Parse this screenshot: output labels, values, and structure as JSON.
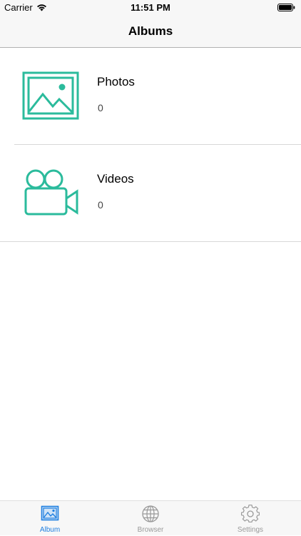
{
  "status_bar": {
    "carrier": "Carrier",
    "time": "11:51 PM"
  },
  "nav": {
    "title": "Albums"
  },
  "albums": [
    {
      "title": "Photos",
      "count": "0",
      "icon": "photo-icon"
    },
    {
      "title": "Videos",
      "count": "0",
      "icon": "video-camera-icon"
    }
  ],
  "tabs": [
    {
      "label": "Album",
      "icon": "image-icon",
      "active": true
    },
    {
      "label": "Browser",
      "icon": "globe-icon",
      "active": false
    },
    {
      "label": "Settings",
      "icon": "gear-icon",
      "active": false
    }
  ],
  "colors": {
    "accent": "#2bbb9c",
    "tab_active": "#1e7fe0",
    "tab_inactive": "#999999"
  }
}
